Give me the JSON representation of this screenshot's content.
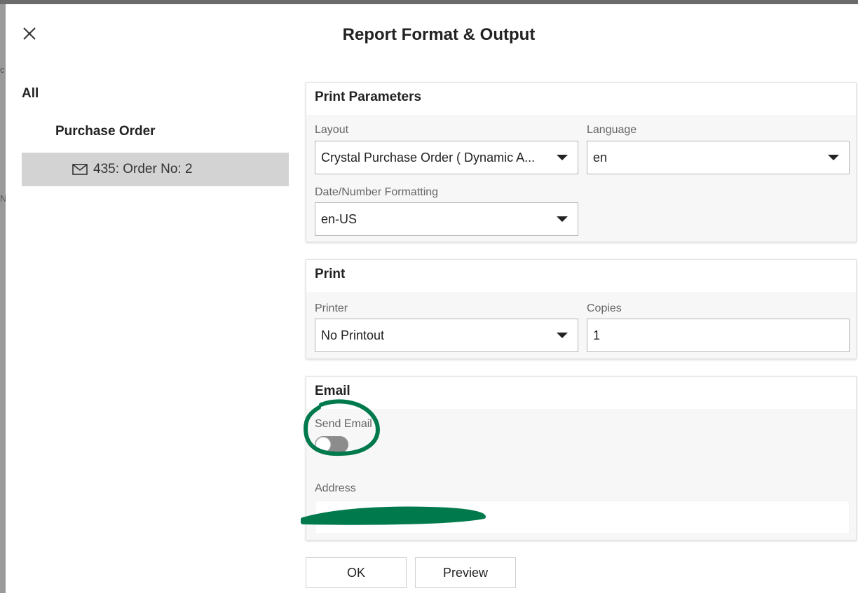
{
  "dialog": {
    "title": "Report Format & Output",
    "ok_label": "OK",
    "preview_label": "Preview"
  },
  "background": {
    "fragments": [
      "c",
      "N"
    ]
  },
  "nav": {
    "all_label": "All",
    "group_label": "Purchase Order",
    "item_label": "435: Order No: 2"
  },
  "print_parameters": {
    "title": "Print Parameters",
    "layout_label": "Layout",
    "layout_value": "Crystal Purchase Order ( Dynamic A...",
    "language_label": "Language",
    "language_value": "en",
    "formatting_label": "Date/Number Formatting",
    "formatting_value": "en-US"
  },
  "print": {
    "title": "Print",
    "printer_label": "Printer",
    "printer_value": "No Printout",
    "copies_label": "Copies",
    "copies_value": "1"
  },
  "email": {
    "title": "Email",
    "send_email_label": "Send Email",
    "send_email_on": false,
    "address_label": "Address",
    "address_value": ""
  },
  "colors": {
    "annotation": "#007a4d",
    "selected_row": "#d3d3d3",
    "toggle_off": "#8c8c8c"
  }
}
